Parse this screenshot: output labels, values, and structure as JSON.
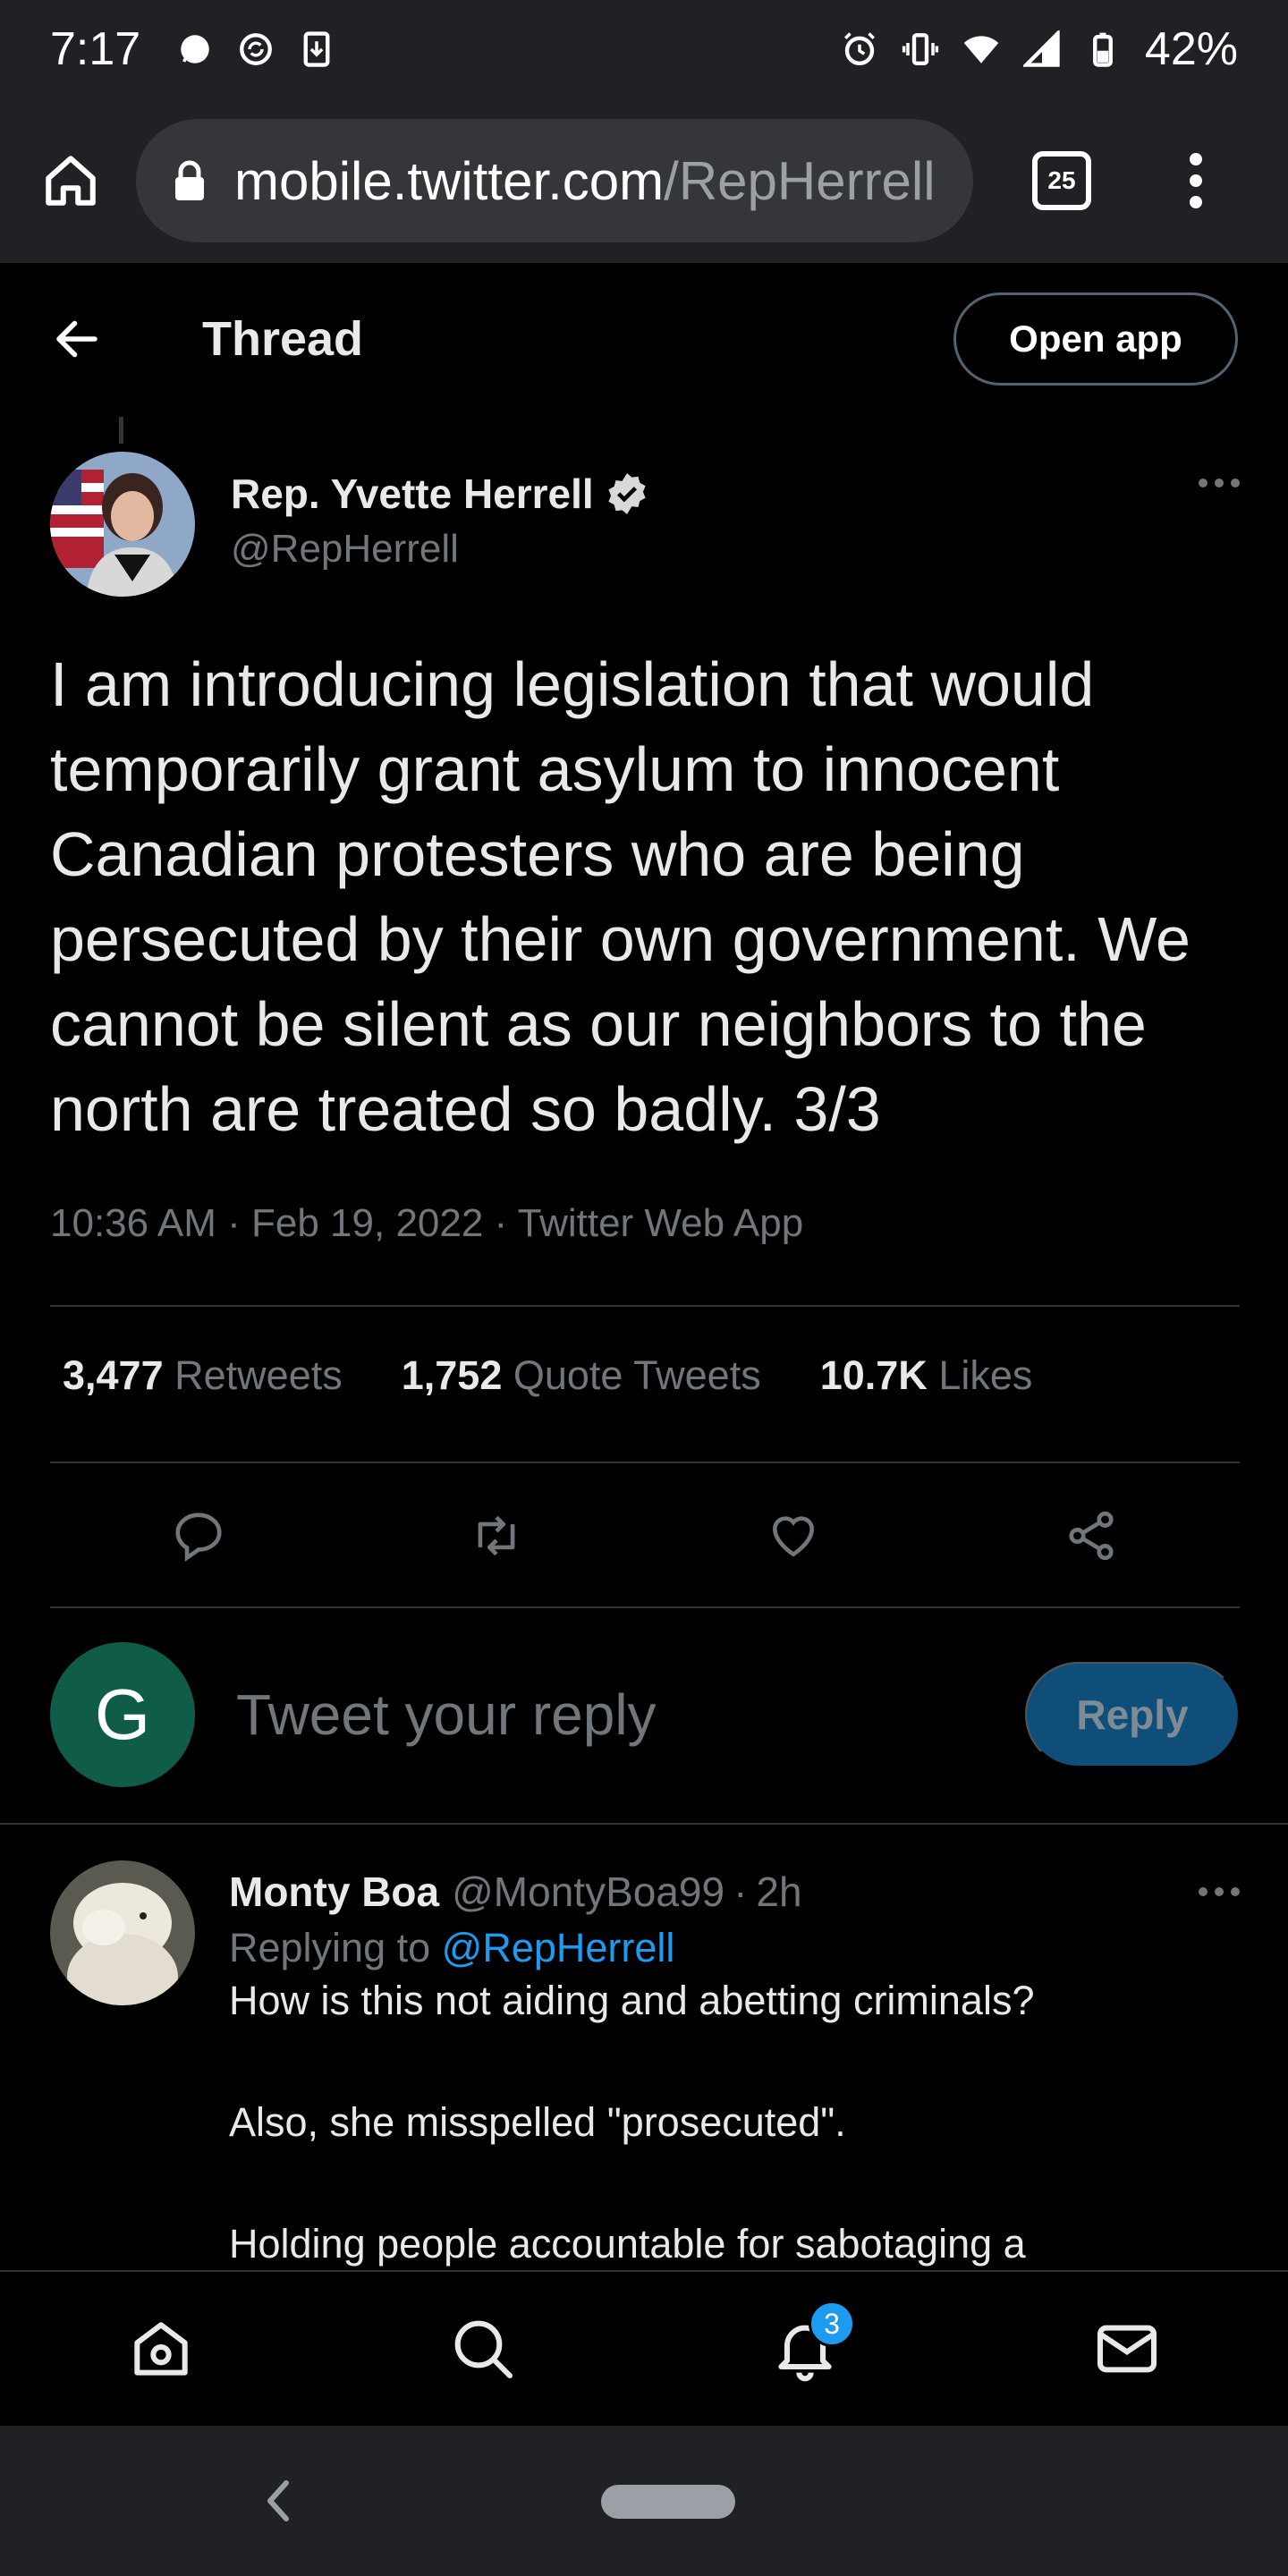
{
  "status_bar": {
    "time": "7:17",
    "battery": "42%"
  },
  "browser": {
    "url_domain": "mobile.twitter.com",
    "url_path": "/RepHerrell",
    "tab_count": "25"
  },
  "header": {
    "title": "Thread",
    "open_app_label": "Open app"
  },
  "tweet": {
    "author_name": "Rep. Yvette Herrell",
    "author_handle": "@RepHerrell",
    "verified": true,
    "text": "I am introducing legislation that would temporarily grant asylum to innocent Canadian protesters who are being persecuted by their own government. We cannot be silent as our neighbors to the north are treated so badly. 3/3",
    "meta": "10:36 AM · Feb 19, 2022 · Twitter Web App",
    "stats": [
      {
        "value": "3,477",
        "label": "Retweets"
      },
      {
        "value": "1,752",
        "label": "Quote Tweets"
      },
      {
        "value": "10.7K",
        "label": "Likes"
      }
    ],
    "actions": [
      "reply-icon",
      "retweet-icon",
      "like-icon",
      "share-icon"
    ]
  },
  "composer": {
    "avatar_letter": "G",
    "placeholder": "Tweet your reply",
    "reply_label": "Reply"
  },
  "reply": {
    "name": "Monty Boa",
    "handle": "@MontyBoa99",
    "separator": "·",
    "time": "2h",
    "replying_prefix": "Replying to",
    "replying_to": "@RepHerrell",
    "lines": [
      "How is this not aiding and abetting criminals?",
      "Also, she misspelled \"prosecuted\".",
      "Holding people accountable for sabotaging a"
    ]
  },
  "bottom_nav": {
    "items": [
      "home-icon",
      "search-icon",
      "notifications-icon",
      "messages-icon"
    ],
    "notification_count": "3"
  },
  "colors": {
    "accent": "#1d9bf0",
    "background": "#000000",
    "chrome": "#202124",
    "muted_text": "#71767b"
  }
}
